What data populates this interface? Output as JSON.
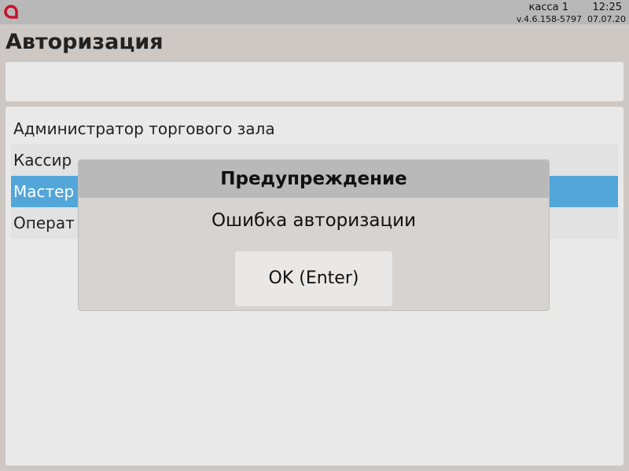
{
  "topbar": {
    "kassa": "касса 1",
    "time": "12:25",
    "version": "v.4.6.158-5797  07.07.20",
    "logo_icon": "brand-logo-icon",
    "logo_color": "#c8102e"
  },
  "page": {
    "title": "Авторизация"
  },
  "users": [
    {
      "label": "Администратор торгового зала"
    },
    {
      "label": "Кассир"
    },
    {
      "label": "Мастер"
    },
    {
      "label": "Операт"
    }
  ],
  "dialog": {
    "title": "Предупреждение",
    "message": "Ошибка авторизации",
    "ok_label": "OK (Enter)"
  },
  "colors": {
    "selection": "#52a6d9",
    "topbar": "#b8b8b8"
  }
}
